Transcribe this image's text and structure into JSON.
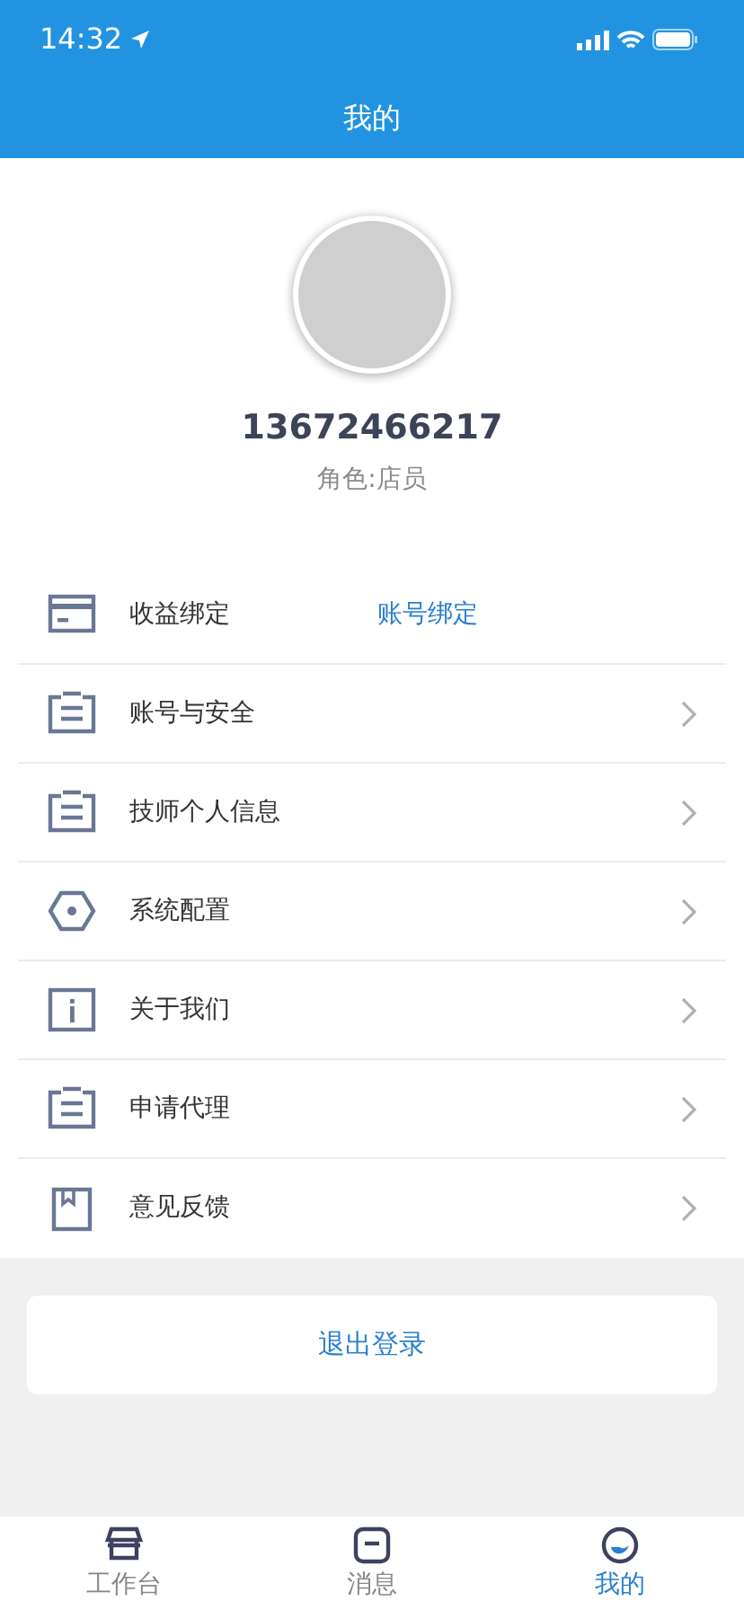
{
  "status_bar": {
    "time": "14:32"
  },
  "header": {
    "title": "我的"
  },
  "profile": {
    "phone": "13672466217",
    "role": "角色:店员"
  },
  "menu": [
    {
      "kind": "link",
      "label": "收益绑定",
      "value": "账号绑定"
    },
    {
      "kind": "nav",
      "label": "账号与安全"
    },
    {
      "kind": "nav",
      "label": "技师个人信息"
    },
    {
      "kind": "nav",
      "label": "系统配置"
    },
    {
      "kind": "nav",
      "label": "关于我们"
    },
    {
      "kind": "nav",
      "label": "申请代理"
    },
    {
      "kind": "nav",
      "label": "意见反馈"
    }
  ],
  "logout": {
    "label": "退出登录"
  },
  "tab_bar": [
    {
      "label": "工作台",
      "selected": false
    },
    {
      "label": "消息",
      "selected": false
    },
    {
      "label": "我的",
      "selected": true
    }
  ]
}
